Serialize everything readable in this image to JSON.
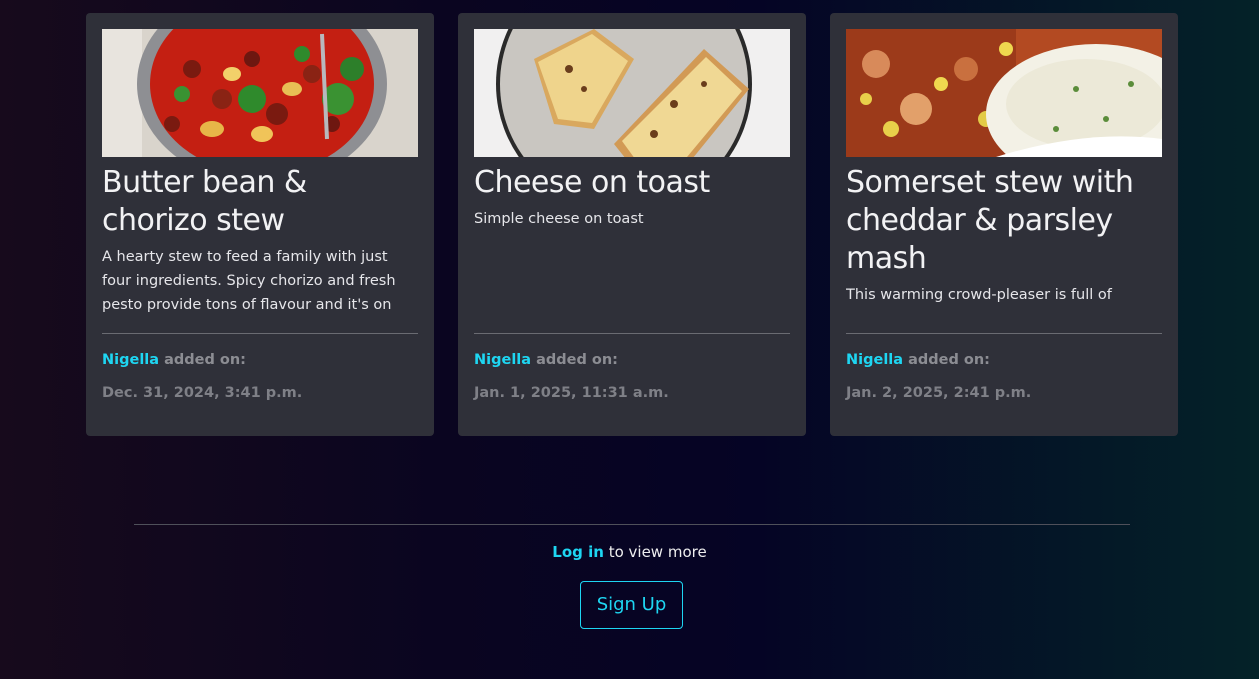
{
  "recipes": [
    {
      "image": "butter-bean-chorizo-stew-photo",
      "title": "Butter bean & chorizo stew",
      "description": "A hearty stew to feed a family with just four ingredients. Spicy chorizo and fresh pesto provide tons of flavour and it's on the table",
      "author": "Nigella",
      "added_label": " added on:",
      "date": "Dec. 31, 2024, 3:41 p.m."
    },
    {
      "image": "cheese-on-toast-photo",
      "title": "Cheese on toast",
      "description": "Simple cheese on toast",
      "author": "Nigella",
      "added_label": " added on:",
      "date": "Jan. 1, 2025, 11:31 a.m."
    },
    {
      "image": "somerset-stew-photo",
      "title": "Somerset stew with cheddar & parsley mash",
      "description": "This warming crowd-pleaser is full of flavour",
      "author": "Nigella",
      "added_label": " added on:",
      "date": "Jan. 2, 2025, 2:41 p.m."
    }
  ],
  "footer": {
    "login_link": "Log in",
    "login_suffix": " to view more",
    "signup_label": "Sign Up"
  },
  "colors": {
    "accent": "#1ed6f2",
    "card_bg": "#2f3039",
    "muted": "#8c8d93"
  }
}
